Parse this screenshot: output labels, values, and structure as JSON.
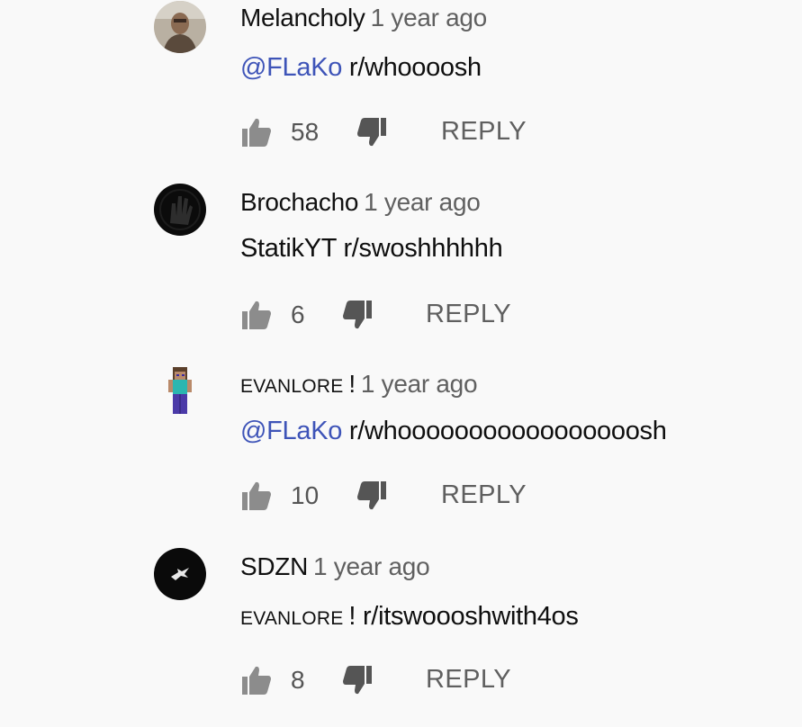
{
  "comments": [
    {
      "author": "Melancholy",
      "author_suffix": "",
      "time": "1 year ago",
      "mention": "@FLaKo",
      "mention_style": "link",
      "text": "r/whoooosh",
      "likes": "58",
      "reply_label": "REPLY",
      "avatar_icon": "user-photo-avatar"
    },
    {
      "author": "Brochacho",
      "author_suffix": "",
      "time": "1 year ago",
      "mention": "StatikYT",
      "mention_style": "plain",
      "text": "r/swoshhhhhh",
      "likes": "6",
      "reply_label": "REPLY",
      "avatar_icon": "dark-hand-avatar"
    },
    {
      "author": "EVANLORE",
      "author_suffix": "!",
      "time": "1 year ago",
      "mention": "@FLaKo",
      "mention_style": "link",
      "text": "r/whooooooooooooooooosh",
      "likes": "10",
      "reply_label": "REPLY",
      "avatar_icon": "minecraft-character-avatar"
    },
    {
      "author": "SDZN",
      "author_suffix": "",
      "time": "1 year ago",
      "mention": "EVANLORE",
      "mention_suffix": "!",
      "mention_style": "smallcaps",
      "text": "r/itswoooshwith4os",
      "likes": "8",
      "reply_label": "REPLY",
      "avatar_icon": "black-logo-avatar"
    }
  ],
  "colors": {
    "background": "#f9f9f9",
    "mention_link": "#3e54b8",
    "secondary_text": "#606060"
  }
}
